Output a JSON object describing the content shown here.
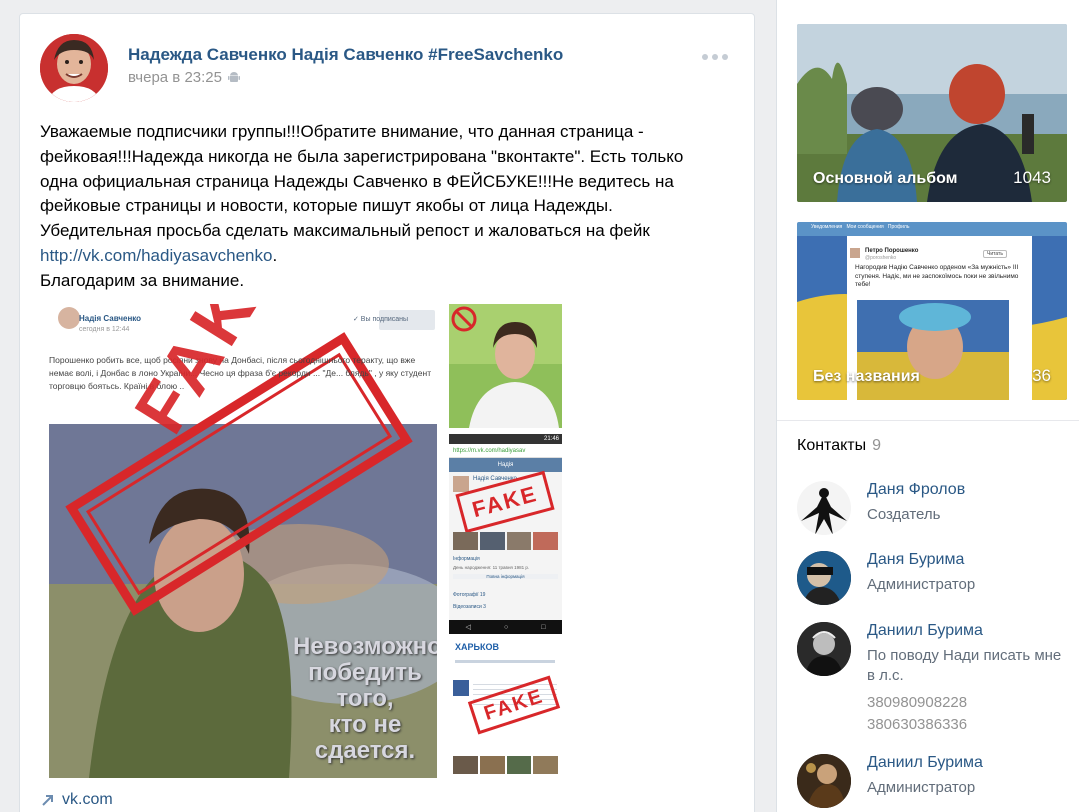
{
  "post": {
    "author": "Надежда Савченко Надія Савченко #FreeSavchenko",
    "time": "вчера в 23:25",
    "text_lines": [
      "Уважаемые подписчики группы!!!Обратите внимание, что данная страница -",
      "фейковая!!!Надежда никогда не была зарегистрирована \"вконтакте\". Есть только",
      "одна официальная страница Надежды Савченко в ФЕЙСБУКЕ!!!Не ведитесь на",
      "фейковые страницы и новости, которые пишут якобы от лица Надежды.",
      "Убедительная просьба сделать максимальный репост и жаловаться на фейк"
    ],
    "link": "http://vk.com/hadiyasavchenko",
    "link_suffix": ".",
    "closing": "Благодарим за внимание.",
    "source_link": "vk.com",
    "images": {
      "main": {
        "header_name": "Надія Савченко",
        "header_time": "сегодня в 12:44",
        "subscribed_label": "✓ Вы подписаны",
        "snippet": "Порошенко робить все, щоб росіяни знову на Донбасі, після сьогоднішнього теракту, що вже немає волі, і Донбас в лоно України... Чесно ця фраза б'є рекорди ... \"Де... блядь\" , у яку студент торговцю боятьсь. Країні в блою ..",
        "stamp": "FAKE",
        "caption": [
          "Невозможно",
          "победить",
          "того,",
          "кто не",
          "сдается."
        ]
      },
      "mid": {
        "status_time": "21:46",
        "url": "https://m.vk.com/hadiyasav",
        "tab": "Надія",
        "profile_name": "Надія Савченко",
        "stamp": "FAKE",
        "info_label": "Інформація",
        "birth": "День народження:  11 травня 1981 р.",
        "more_info": "Повна інформація",
        "photos": "Фотографії 19",
        "videos": "Відеозаписи 3"
      },
      "bot": {
        "site": "ХАРЬКОВ",
        "stamp": "FAKE"
      }
    }
  },
  "sidebar": {
    "albums": [
      {
        "title": "Основной альбом",
        "count": "1043"
      },
      {
        "title": "Без названия",
        "count": "36",
        "tweet_author": "Петро Порошенко",
        "tweet_handle": "@poroshenko",
        "tweet_follow": "Читать",
        "tweet_text": "Нагородив Надію Савченко орденом «За мужність» III ступеня. Надіє, ми не заспокоїмось поки не звільнимо тебе!",
        "twitter_menu": [
          "Уведомления",
          "Мои сообщения",
          "Профиль"
        ]
      }
    ],
    "contacts_label": "Контакты",
    "contacts_count": "9",
    "contacts": [
      {
        "name": "Даня Фролов",
        "role": "Создатель"
      },
      {
        "name": "Даня Бурима",
        "role": "Администратор"
      },
      {
        "name": "Даниил Бурима",
        "role": "По поводу Нади писать мне в л.с.",
        "phones": [
          "380980908228",
          "380630386336"
        ]
      },
      {
        "name": "Даниил Бурима",
        "role": "Администратор"
      }
    ]
  }
}
